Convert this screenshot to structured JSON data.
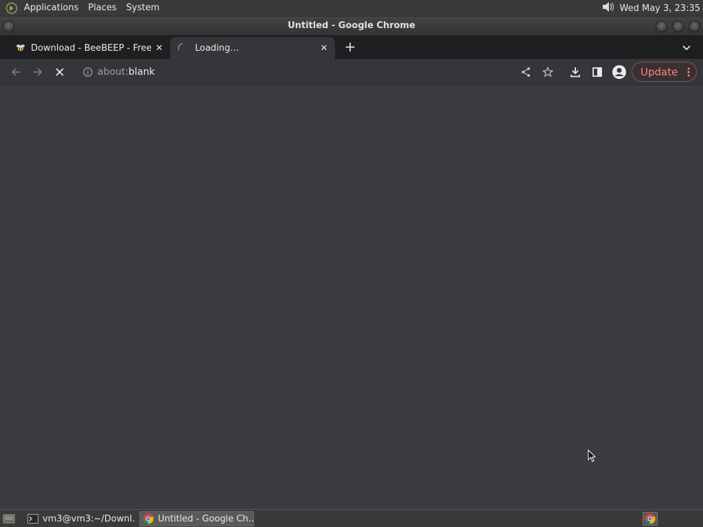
{
  "panel": {
    "menus": [
      "Applications",
      "Places",
      "System"
    ],
    "clock": "Wed May  3, 23:35"
  },
  "window": {
    "title": "Untitled - Google Chrome"
  },
  "tabs": [
    {
      "title": "Download - BeeBEEP - Free C",
      "icon": "beebeep-favicon-icon",
      "close": "✕"
    },
    {
      "title": "Loading…",
      "icon": "loading-spinner-icon",
      "close": "✕"
    }
  ],
  "new_tab_label": "+",
  "toolbar": {
    "url_scheme": "about:",
    "url_host": "blank",
    "update_label": "Update"
  },
  "taskbar": {
    "items": [
      {
        "label": "vm3@vm3:~/Downl…",
        "icon": "terminal-icon"
      },
      {
        "label": "Untitled - Google Ch…",
        "icon": "chrome-icon"
      }
    ]
  },
  "colors": {
    "content_bg": "#3c3c40",
    "tab_strip_bg": "#1f1f22",
    "toolbar_bg": "#35363a",
    "update_accent": "#f28b82"
  }
}
